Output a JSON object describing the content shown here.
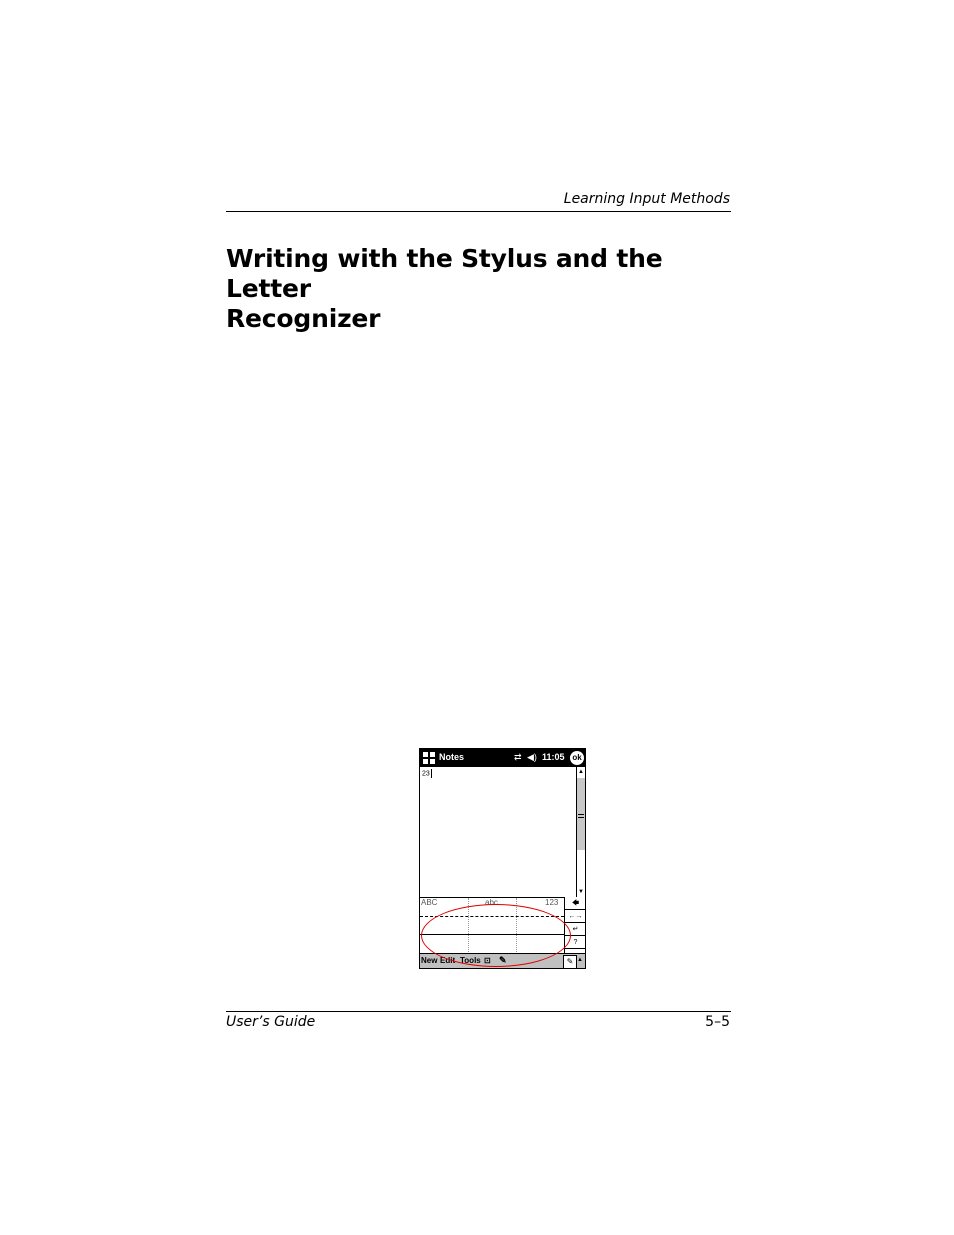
{
  "header": {
    "running_head": "Learning Input Methods"
  },
  "section": {
    "title_line1": "Writing with the Stylus and the Letter",
    "title_line2": "Recognizer"
  },
  "device": {
    "title_bar": {
      "start_icon": "windows-flag-icon",
      "app_title": "Notes",
      "connectivity_icon": "connectivity-icon",
      "volume_icon": "speaker-icon",
      "clock": "11:05",
      "ok_label": "ok"
    },
    "note": {
      "text": "23"
    },
    "scrollbar": {
      "up": "▲",
      "down": "▼"
    },
    "recognizer": {
      "zone_upper": "ABC",
      "zone_lower": "abc",
      "zone_numeric": "123"
    },
    "keys": [
      {
        "label": "🡄",
        "icon": "backspace-icon"
      },
      {
        "label": "←→",
        "icon": "arrows-icon"
      },
      {
        "label": "↵",
        "icon": "enter-icon"
      },
      {
        "label": "?",
        "icon": "help-icon"
      }
    ],
    "menu": {
      "new": "New",
      "edit": "Edit",
      "tools": "Tools",
      "recorder_icon": "recorder-icon",
      "pen_icon": "pen-icon",
      "sip_icon": "input-panel-icon",
      "sip_arrow": "▲"
    }
  },
  "footer": {
    "left": "User’s Guide",
    "right": "5–5"
  },
  "colors": {
    "highlight": "#e00000",
    "titlebar": "#000000",
    "menubar": "#c0c0c0"
  }
}
